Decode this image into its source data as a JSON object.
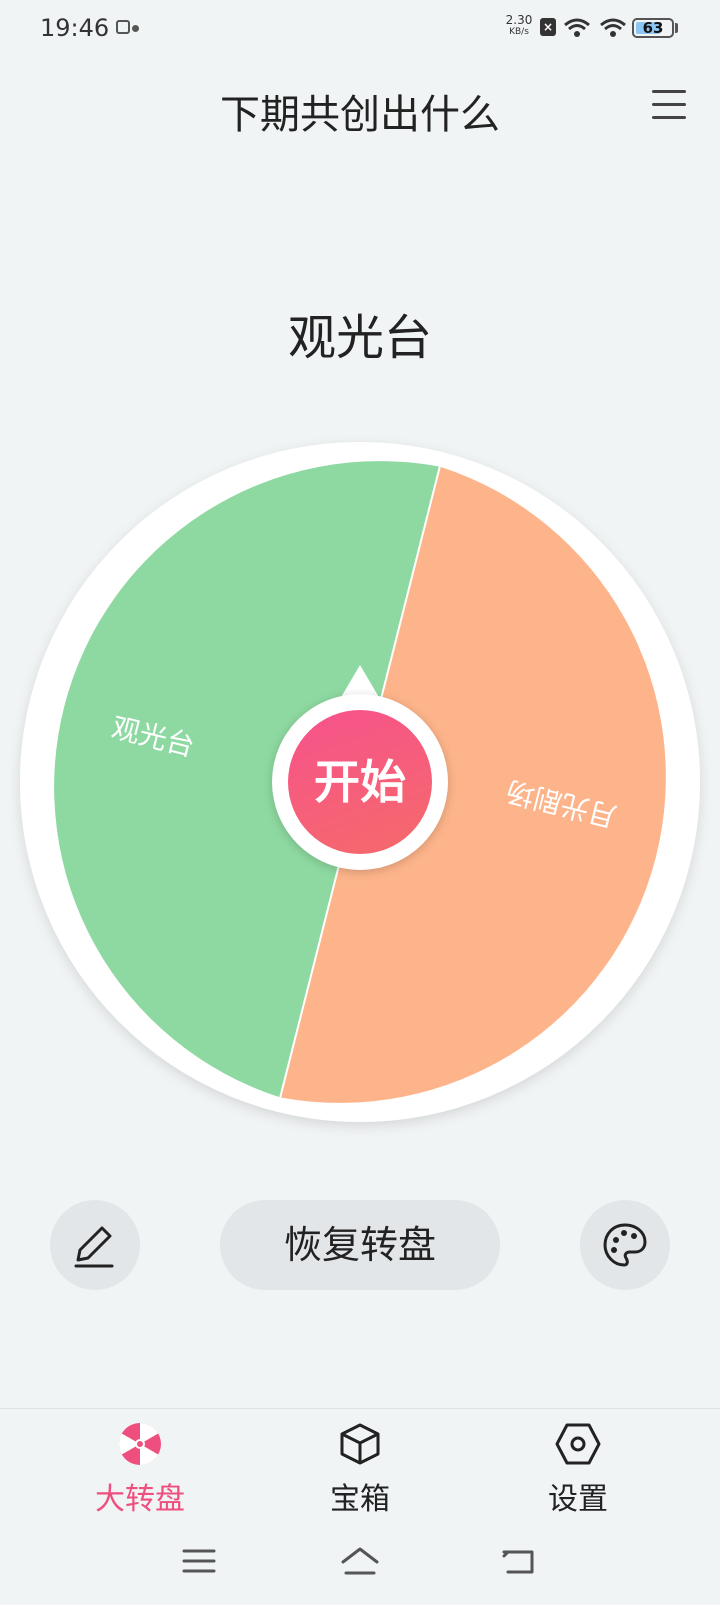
{
  "status_bar": {
    "time": "19:46",
    "net_speed_value": "2.30",
    "net_speed_unit": "KB/s",
    "battery": "63"
  },
  "header": {
    "title": "下期共创出什么"
  },
  "result_label": "观光台",
  "wheel": {
    "segments": [
      {
        "label": "观光台",
        "color": "#8ed9a1"
      },
      {
        "label": "月光剧场",
        "color": "#fdb48a"
      }
    ],
    "start_label": "开始"
  },
  "actions": {
    "reset_label": "恢复转盘"
  },
  "bottom_nav": [
    {
      "label": "大转盘",
      "icon": "wheel-icon",
      "active": true
    },
    {
      "label": "宝箱",
      "icon": "cube-icon",
      "active": false
    },
    {
      "label": "设置",
      "icon": "hexagon-settings-icon",
      "active": false
    }
  ],
  "colors": {
    "accent": "#ee4f7e",
    "background": "#f1f4f5"
  }
}
